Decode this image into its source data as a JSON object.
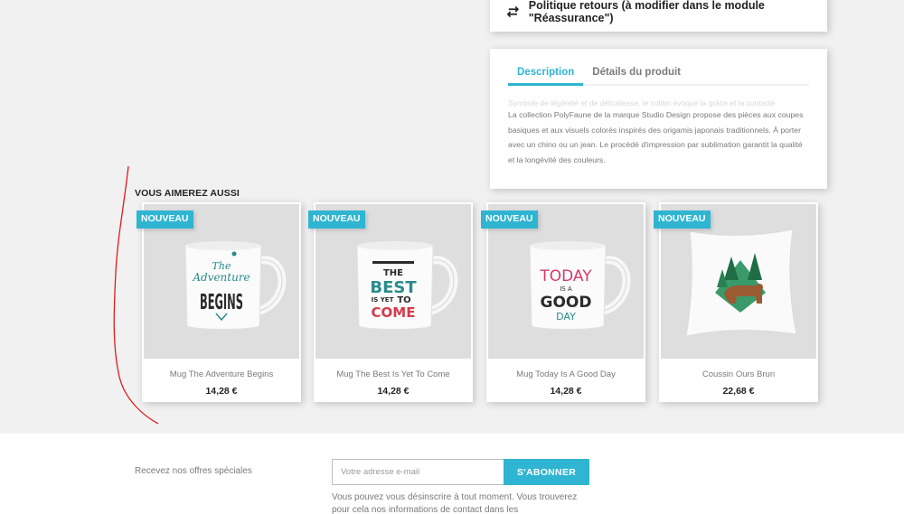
{
  "reassurance": {
    "icon": "arrows-exchange-icon",
    "label": "Politique retours (à modifier dans le module \"Réassurance\")"
  },
  "product_tabs": {
    "tabs": [
      {
        "label": "Description",
        "active": true
      },
      {
        "label": "Détails du produit",
        "active": false
      }
    ],
    "faded_text": "Symbole de légèreté et de délicatesse, le colibri évoque la grâce et la curiosité",
    "description": "La collection PolyFaune de la marque Studio Design propose des pièces aux coupes basiques et aux visuels colorés inspirés des origamis japonais traditionnels. À porter avec un chino ou un jean. Le procédé d'impression par sublimation garantit la qualité et la longévité des couleurs."
  },
  "accessories": {
    "title": "VOUS AIMEREZ AUSSI",
    "products": [
      {
        "badge": "NOUVEAU",
        "name": "Mug The Adventure Begins",
        "price": "14,28 €",
        "image": "mug-adventure-image"
      },
      {
        "badge": "NOUVEAU",
        "name": "Mug The Best Is Yet To Come",
        "price": "14,28 €",
        "image": "mug-best-image"
      },
      {
        "badge": "NOUVEAU",
        "name": "Mug Today Is A Good Day",
        "price": "14,28 €",
        "image": "mug-today-image"
      },
      {
        "badge": "NOUVEAU",
        "name": "Coussin Ours Brun",
        "price": "22,68 €",
        "image": "cushion-bear-image"
      }
    ],
    "mug_art": {
      "adventure": {
        "line1": "The",
        "line2": "Adventure",
        "line3": "BEGINS"
      },
      "best": {
        "line1": "THE",
        "line2": "BEST",
        "line3a": "IS YET",
        "line3b": "TO",
        "line4": "COME"
      },
      "today": {
        "line1": "TODAY",
        "line2": "IS A",
        "line3": "GOOD",
        "line4": "DAY"
      }
    }
  },
  "newsletter": {
    "label": "Recevez nos offres spéciales",
    "placeholder": "Votre adresse e-mail",
    "button": "S'ABONNER",
    "note": "Vous pouvez vous désinscrire à tout moment. Vous trouverez pour cela nos informations de contact dans les"
  },
  "colors": {
    "accent": "#2fb5d2",
    "background": "#f1f1f1",
    "annotation": "#e01b1b"
  }
}
